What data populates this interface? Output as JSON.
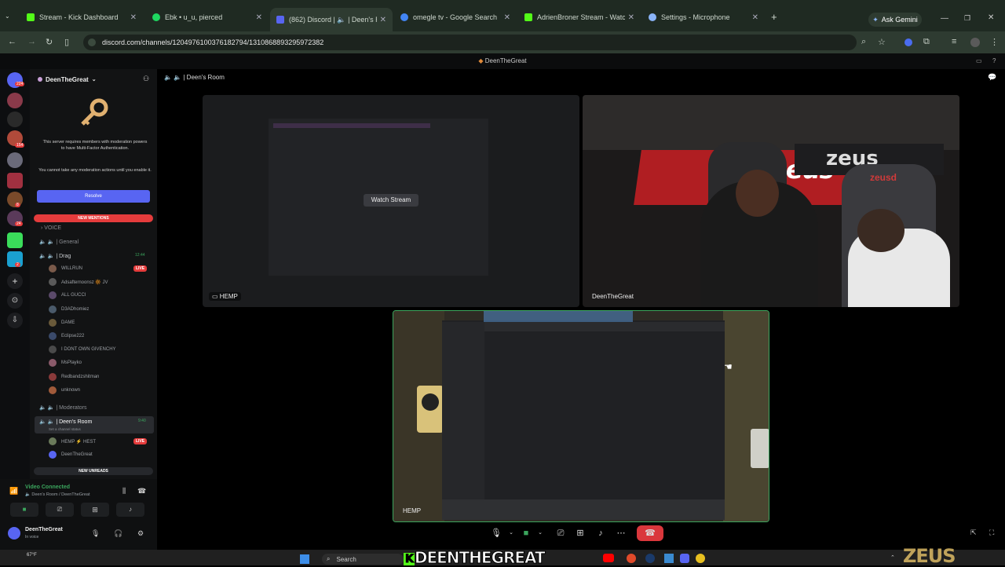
{
  "browser": {
    "tabs": [
      {
        "label": "Stream - Kick Dashboard",
        "color": "#53fc18"
      },
      {
        "label": "Ebk • u_u, pierced",
        "color": "#1ed760"
      },
      {
        "label": "(862) Discord | 🔈 | Deen's R",
        "color": "#5865f2"
      },
      {
        "label": "omegle tv - Google Search",
        "color": "#4285f4"
      },
      {
        "label": "AdrienBroner Stream - Watch L",
        "color": "#53fc18"
      },
      {
        "label": "Settings - Microphone",
        "color": "#8ab4f8"
      }
    ],
    "new_tab": "+",
    "ask_gemini": "Ask Gemini",
    "url": "discord.com/channels/1204976100376182794/1310868893295972382"
  },
  "discord": {
    "window_title": "DeenTheGreat",
    "guild_badges": [
      "224",
      "154",
      "8",
      "24",
      "2"
    ],
    "server_name": "DeenTheGreat",
    "mfa": {
      "line1": "This server requires members with moderation powers to have Multi-Factor Authentication.",
      "line2": "You cannot take any moderation actions until you enable it.",
      "button": "Resolve"
    },
    "new_mentions": "NEW MENTIONS",
    "voice_category": "VOICE",
    "channels": {
      "general": "| General",
      "drag": "| Drag",
      "drag_time": "12:44",
      "moderators": "| Moderators",
      "deens_room": "| Deen's Room",
      "deens_room_time": "9:40",
      "deens_room_status": "Set a channel status"
    },
    "drag_members": [
      {
        "name": "WILLRUN",
        "live": "LIVE",
        "color": "#7a5a4a"
      },
      {
        "name": "Adsafternoonsz 🔆 JV",
        "live": "",
        "color": "#5a5a5a"
      },
      {
        "name": "ALL GUCCI",
        "live": "",
        "color": "#5b4a6a"
      },
      {
        "name": "D3ADhomiez",
        "live": "",
        "color": "#4a5a6a"
      },
      {
        "name": "DAME",
        "live": "",
        "color": "#6a5a3a"
      },
      {
        "name": "Eclipse222",
        "live": "",
        "color": "#3a4a6a"
      },
      {
        "name": "I DONT OWN GIVENCHY",
        "live": "",
        "color": "#4a4a4a"
      },
      {
        "name": "MsPlayko",
        "live": "",
        "color": "#8a5a6a"
      },
      {
        "name": "Redbandzshitman",
        "live": "",
        "color": "#8a3a3a"
      },
      {
        "name": "unknown",
        "live": "",
        "color": "#a05a3a"
      }
    ],
    "room_members": [
      {
        "name": "HEMP ⚡ HEST",
        "live": "LIVE",
        "color": "#6a7a5a"
      },
      {
        "name": "DeenTheGreat",
        "live": "",
        "color": "#5865f2"
      }
    ],
    "new_unreads": "NEW UNREADS",
    "voice_status": {
      "title": "Video Connected",
      "channel": "Deen's Room / DeenTheGreat"
    },
    "user": {
      "name": "DeenTheGreat",
      "status": "In voice"
    },
    "header": {
      "room": "| Deen's Room"
    },
    "tiles": {
      "stream_tile": {
        "name": "HEMP",
        "watch": "Watch Stream"
      },
      "cam_tile": {
        "name": "DeenTheGreat"
      },
      "screen_tile": {
        "name": "HEMP"
      }
    },
    "cam_scene_text": [
      "zeus",
      "zeus",
      "zeusd"
    ]
  },
  "overlay": {
    "name": "DEENTHEGREAT",
    "brand": "ZEUS"
  },
  "taskbar": {
    "temp": "67°F",
    "search": "Search"
  }
}
